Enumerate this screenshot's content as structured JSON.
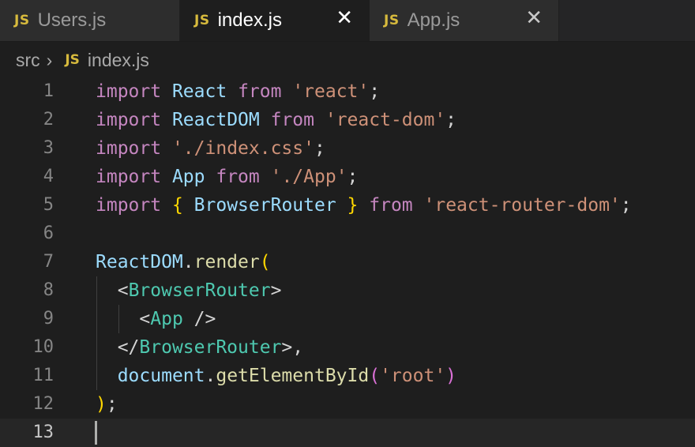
{
  "tabs": [
    {
      "badge": "JS",
      "name": "Users.js",
      "active": false,
      "close": ""
    },
    {
      "badge": "JS",
      "name": "index.js",
      "active": true,
      "close": "✕"
    },
    {
      "badge": "JS",
      "name": "App.js",
      "active": false,
      "close": "✕"
    }
  ],
  "breadcrumb": {
    "root": "src",
    "separator": "›",
    "badge": "JS",
    "file": "index.js"
  },
  "colors": {
    "keyword": "#c586c0",
    "variable": "#9cdcfe",
    "string": "#ce9178",
    "function": "#dcdcaa",
    "tag": "#4ec9b0",
    "punctuation": "#d4d4d4",
    "bracket": "#ffd700",
    "paren": "#da70d6",
    "js_badge": "#d7ba3d"
  },
  "lines": [
    {
      "num": "1",
      "tokens": [
        [
          "import",
          "keyword"
        ],
        [
          " ",
          ""
        ],
        [
          "React",
          "variable"
        ],
        [
          " ",
          ""
        ],
        [
          "from",
          "keyword"
        ],
        [
          " ",
          ""
        ],
        [
          "'react'",
          "string"
        ],
        [
          ";",
          "punctuation"
        ]
      ]
    },
    {
      "num": "2",
      "tokens": [
        [
          "import",
          "keyword"
        ],
        [
          " ",
          ""
        ],
        [
          "ReactDOM",
          "variable"
        ],
        [
          " ",
          ""
        ],
        [
          "from",
          "keyword"
        ],
        [
          " ",
          ""
        ],
        [
          "'react-dom'",
          "string"
        ],
        [
          ";",
          "punctuation"
        ]
      ]
    },
    {
      "num": "3",
      "tokens": [
        [
          "import",
          "keyword"
        ],
        [
          " ",
          ""
        ],
        [
          "'./index.css'",
          "string"
        ],
        [
          ";",
          "punctuation"
        ]
      ]
    },
    {
      "num": "4",
      "tokens": [
        [
          "import",
          "keyword"
        ],
        [
          " ",
          ""
        ],
        [
          "App",
          "variable"
        ],
        [
          " ",
          ""
        ],
        [
          "from",
          "keyword"
        ],
        [
          " ",
          ""
        ],
        [
          "'./App'",
          "string"
        ],
        [
          ";",
          "punctuation"
        ]
      ]
    },
    {
      "num": "5",
      "tokens": [
        [
          "import",
          "keyword"
        ],
        [
          " ",
          ""
        ],
        [
          "{",
          "bracket"
        ],
        [
          " ",
          ""
        ],
        [
          "BrowserRouter",
          "variable"
        ],
        [
          " ",
          ""
        ],
        [
          "}",
          "bracket"
        ],
        [
          " ",
          ""
        ],
        [
          "from",
          "keyword"
        ],
        [
          " ",
          ""
        ],
        [
          "'react-router-dom'",
          "string"
        ],
        [
          ";",
          "punctuation"
        ]
      ]
    },
    {
      "num": "6",
      "tokens": []
    },
    {
      "num": "7",
      "tokens": [
        [
          "ReactDOM",
          "variable"
        ],
        [
          ".",
          "punctuation"
        ],
        [
          "render",
          "function"
        ],
        [
          "(",
          "bracket"
        ]
      ]
    },
    {
      "num": "8",
      "tokens": [
        [
          "  ",
          ""
        ],
        [
          "<",
          "punctuation"
        ],
        [
          "BrowserRouter",
          "tag"
        ],
        [
          ">",
          "punctuation"
        ]
      ]
    },
    {
      "num": "9",
      "tokens": [
        [
          "    ",
          ""
        ],
        [
          "<",
          "punctuation"
        ],
        [
          "App",
          "tag"
        ],
        [
          " />",
          "punctuation"
        ]
      ]
    },
    {
      "num": "10",
      "tokens": [
        [
          "  ",
          ""
        ],
        [
          "</",
          "punctuation"
        ],
        [
          "BrowserRouter",
          "tag"
        ],
        [
          ">,",
          "punctuation"
        ]
      ]
    },
    {
      "num": "11",
      "tokens": [
        [
          "  ",
          ""
        ],
        [
          "document",
          "variable"
        ],
        [
          ".",
          "punctuation"
        ],
        [
          "getElementById",
          "function"
        ],
        [
          "(",
          "paren"
        ],
        [
          "'root'",
          "string"
        ],
        [
          ")",
          "paren"
        ]
      ]
    },
    {
      "num": "12",
      "tokens": [
        [
          ")",
          "bracket"
        ],
        [
          ";",
          "punctuation"
        ]
      ]
    },
    {
      "num": "13",
      "tokens": [],
      "current": true
    }
  ]
}
